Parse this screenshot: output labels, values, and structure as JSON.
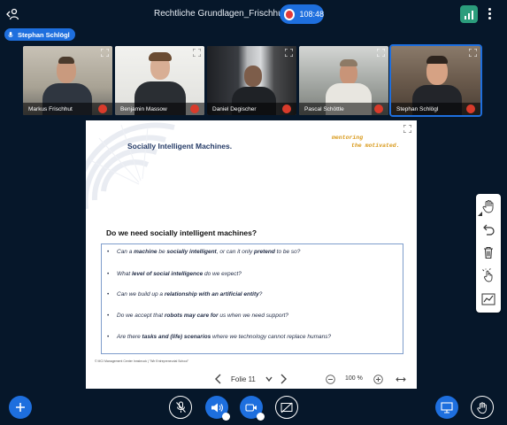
{
  "header": {
    "room_title": "Rechtliche Grundlagen_Frischhut",
    "recording_time": "108:48",
    "colors": {
      "accent": "#1e6fde",
      "stats": "#2b9d7c",
      "background": "#06172a"
    }
  },
  "talker": {
    "name": "Stephan Schlögl"
  },
  "participants": [
    {
      "name": "Markus Frischhut",
      "muted": true
    },
    {
      "name": "Benjamin Massow",
      "muted": true
    },
    {
      "name": "Daniel Degischer",
      "muted": true
    },
    {
      "name": "Pascal Schöttle",
      "muted": true
    },
    {
      "name": "Stephan Schlögl",
      "muted": true,
      "active": true
    }
  ],
  "slide": {
    "title": "Socially Intelligent Machines.",
    "brand_line1": "mentoring",
    "brand_line2": "the motivated.",
    "question": "Do we need socially intelligent machines?",
    "bullets": [
      [
        {
          "t": "Can a "
        },
        {
          "t": "machine",
          "b": true
        },
        {
          "t": " be "
        },
        {
          "t": "socially intelligent",
          "b": true
        },
        {
          "t": ", or can it only "
        },
        {
          "t": "pretend",
          "b": true
        },
        {
          "t": " to be so?"
        }
      ],
      [
        {
          "t": "What "
        },
        {
          "t": "level of social intelligence",
          "b": true
        },
        {
          "t": " do we expect?"
        }
      ],
      [
        {
          "t": "Can we build up a "
        },
        {
          "t": "relationship with an artificial entity",
          "b": true
        },
        {
          "t": "?"
        }
      ],
      [
        {
          "t": "Do we accept that "
        },
        {
          "t": "robots may care for",
          "b": true
        },
        {
          "t": " us when we need support?"
        }
      ],
      [
        {
          "t": "Are there "
        },
        {
          "t": "tasks and (life) scenarios",
          "b": true
        },
        {
          "t": " where we technology cannot replace humans?"
        }
      ]
    ],
    "footer": "© MCI Management Center Innsbruck | \"Wir Entrepreneurial School\""
  },
  "slide_nav": {
    "slide_label": "Folie 11",
    "zoom": "100 %"
  },
  "whiteboard_tools": [
    "hand-icon",
    "undo-icon",
    "trash-icon",
    "multi-user-pointer-icon",
    "chart-line-icon"
  ],
  "bottom_controls": [
    "actions-plus",
    "mic-muted",
    "audio-speaker",
    "camera",
    "screenshare-off",
    "presentation",
    "raise-hand"
  ]
}
